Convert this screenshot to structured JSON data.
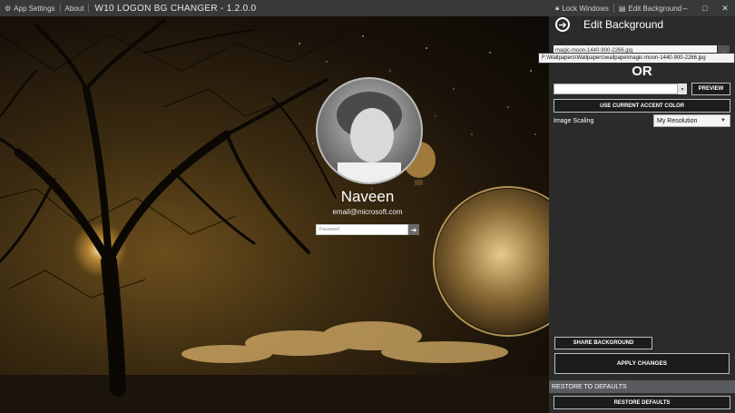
{
  "titlebar": {
    "app_settings": "App Settings",
    "about": "About",
    "app_title": "W10 LOGON BG CHANGER - 1.2.0.0",
    "lock_windows": "Lock Windows",
    "edit_background": "Edit Background",
    "minimize": "–",
    "maximize": "□",
    "close": "✕"
  },
  "login": {
    "user_name": "Naveen",
    "email": "email@microsoft.com",
    "password_placeholder": "Password",
    "go_arrow": "➜"
  },
  "panel": {
    "back_arrow": "➜",
    "title": "Edit Background",
    "file_value": "magic-moon-1440-900-2266.jpg",
    "file_button": "…",
    "tooltip_path": "F:\\Wallpapers\\Wallpapers\\wallpape\\magic-moon-1440-900-2266.jpg",
    "or_label": "OR",
    "color_value": "",
    "color_dropdown": "▾",
    "preview_label": "PREVIEW",
    "accent_label": "USE CURRENT ACCENT COLOR",
    "scaling_label": "Image Scaling",
    "scaling_value": "My Resolution",
    "scaling_chevron": "▼",
    "share_label": "SHARE BACKGROUND",
    "apply_label": "APPLY CHANGES",
    "restore_header": "RESTORE TO DEFAULTS",
    "restore_label": "RESTORE DEFAULTS"
  },
  "colors": {
    "panel_bg": "#2b2b2b",
    "titlebar_bg": "#37393b",
    "restore_header_bg": "#595b5e",
    "scene_sepia": "#6b4e1c"
  }
}
